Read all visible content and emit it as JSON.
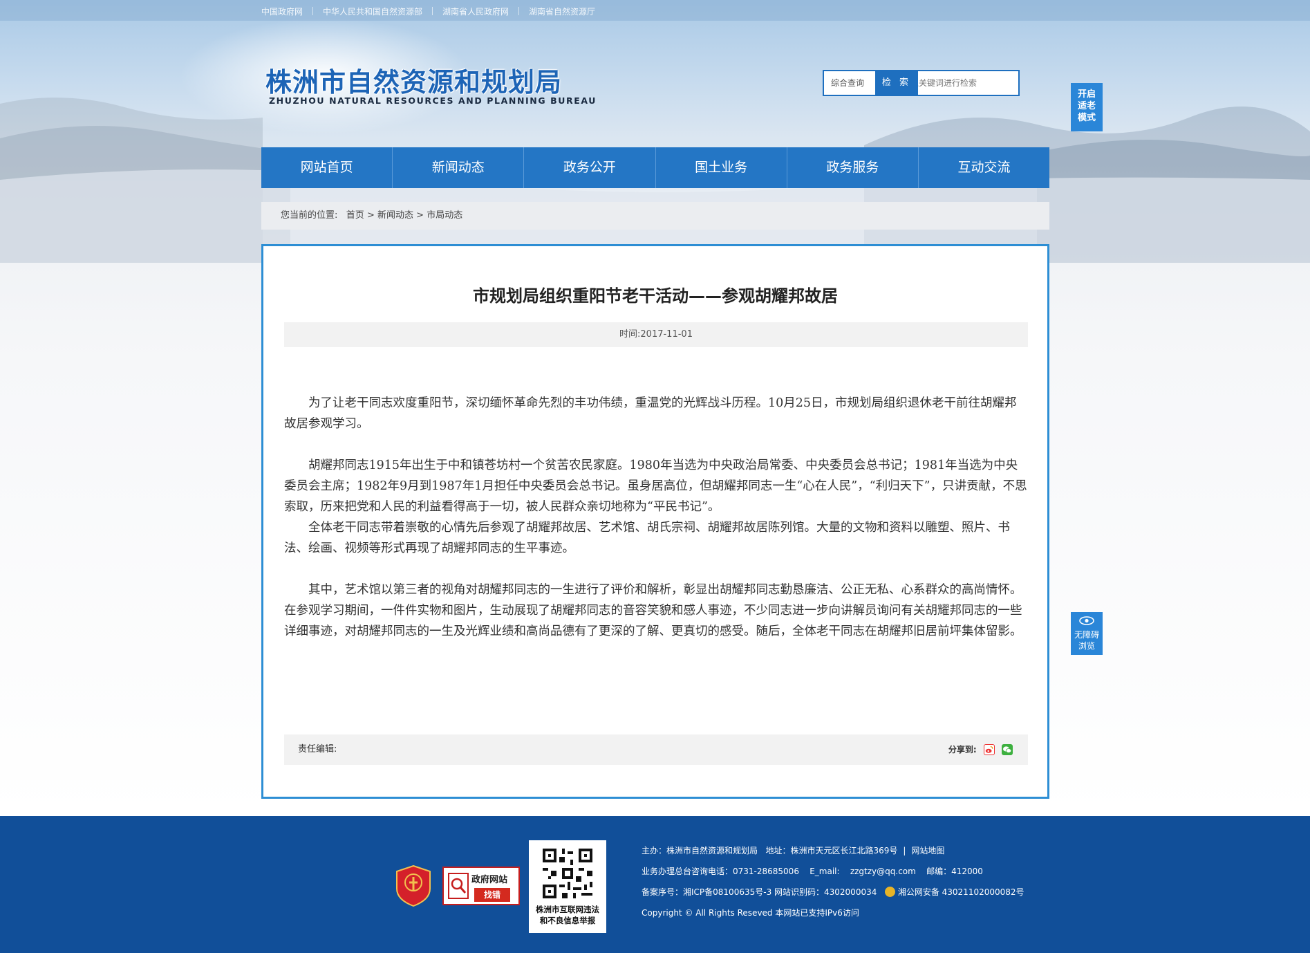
{
  "top_links": [
    "中国政府网",
    "中华人民共和国自然资源部",
    "湖南省人民政府网",
    "湖南省自然资源厅"
  ],
  "logo": {
    "cn": "株洲市自然资源和规划局",
    "en": "ZHUZHOU NATURAL RESOURCES AND PLANNING BUREAU"
  },
  "search": {
    "scope": "综合查询",
    "placeholder": "请输入关键词进行检索",
    "button": "检 索"
  },
  "side": {
    "elder_mode": [
      "开启",
      "适老",
      "模式"
    ],
    "accessible": [
      "无障碍",
      "浏览"
    ]
  },
  "nav": [
    "网站首页",
    "新闻动态",
    "政务公开",
    "国土业务",
    "政务服务",
    "互动交流"
  ],
  "breadcrumb": {
    "label": "您当前的位置:",
    "items": [
      "首页",
      "新闻动态",
      "市局动态"
    ],
    "sep": ">"
  },
  "article": {
    "title": "市规划局组织重阳节老干活动——参观胡耀邦故居",
    "time": "时间:2017-11-01",
    "paragraphs": [
      "为了让老干同志欢度重阳节，深切缅怀革命先烈的丰功伟绩，重温党的光辉战斗历程。10月25日，市规划局组织退休老干前往胡耀邦故居参观学习。",
      "胡耀邦同志1915年出生于中和镇苍坊村一个贫苦农民家庭。1980年当选为中央政治局常委、中央委员会总书记；1981年当选为中央委员会主席；1982年9月到1987年1月担任中央委员会总书记。虽身居高位，但胡耀邦同志一生“心在人民”，“利归天下”，只讲贡献，不思索取，历来把党和人民的利益看得高于一切，被人民群众亲切地称为“平民书记”。",
      "全体老干同志带着崇敬的心情先后参观了胡耀邦故居、艺术馆、胡氏宗祠、胡耀邦故居陈列馆。大量的文物和资料以雕塑、照片、书法、绘画、视频等形式再现了胡耀邦同志的生平事迹。",
      "其中，艺术馆以第三者的视角对胡耀邦同志的一生进行了评价和解析，彰显出胡耀邦同志勤恳廉洁、公正无私、心系群众的高尚情怀。在参观学习期间，一件件实物和图片，生动展现了胡耀邦同志的音容笑貌和感人事迹，不少同志进一步向讲解员询问有关胡耀邦同志的一些详细事迹，对胡耀邦同志的一生及光辉业绩和高尚品德有了更深的了解、更真切的感受。随后，全体老干同志在胡耀邦旧居前坪集体留影。"
    ],
    "editor": "责任编辑:",
    "share": "分享到:"
  },
  "footer": {
    "party_badge": "党政机关",
    "find_error": {
      "line1": "政府网站",
      "line2": "找错"
    },
    "qr_caption": [
      "株洲市互联网违法",
      "和不良信息举报"
    ],
    "line1": {
      "host": "主办：株洲市自然资源和规划局",
      "address": "地址：株洲市天元区长江北路369号",
      "sitemap": "网站地图"
    },
    "line2": {
      "phone": "业务办理总台咨询电话：0731-28685006",
      "email_label": "E_mail:",
      "email": "zzgtzy@qq.com",
      "postcode": "邮编：412000"
    },
    "line3": {
      "icp": "备案序号：湘ICP备08100635号-3 网站识别码：4302000034",
      "police": "湘公网安备 43021102000082号"
    },
    "line4": "Copyright © All Rights Reseved 本网站已支持IPv6访问"
  },
  "colors": {
    "primary": "#2476c5",
    "footer": "#114f99",
    "border": "#2d8ed4",
    "side": "#2a86d8"
  }
}
